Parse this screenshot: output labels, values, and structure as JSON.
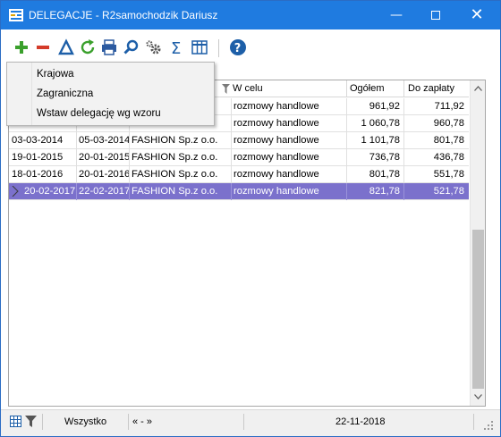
{
  "window": {
    "title": "DELEGACJE - R2samochodzik Dariusz"
  },
  "menu": {
    "items": [
      {
        "label": "Krajowa"
      },
      {
        "label": "Zagraniczna"
      },
      {
        "label": "Wstaw delegację wg wzoru"
      }
    ]
  },
  "grid": {
    "columns": [
      {
        "label": "W celu"
      },
      {
        "label": "Ogółem"
      },
      {
        "label": "Do zapłaty"
      }
    ],
    "rows": [
      {
        "od": "",
        "do": "",
        "firma": "",
        "cel": "rozmowy handlowe",
        "ogolem": "961,92",
        "doZaplaty": "711,92"
      },
      {
        "od": "",
        "do": "",
        "firma": "",
        "cel": "rozmowy handlowe",
        "ogolem": "1 060,78",
        "doZaplaty": "960,78"
      },
      {
        "od": "03-03-2014",
        "do": "05-03-2014",
        "firma": "FASHION Sp.z o.o.",
        "cel": "rozmowy handlowe",
        "ogolem": "1 101,78",
        "doZaplaty": "801,78"
      },
      {
        "od": "19-01-2015",
        "do": "20-01-2015",
        "firma": "FASHION Sp.z o.o.",
        "cel": "rozmowy handlowe",
        "ogolem": "736,78",
        "doZaplaty": "436,78"
      },
      {
        "od": "18-01-2016",
        "do": "20-01-2016",
        "firma": "FASHION Sp.z o.o.",
        "cel": "rozmowy handlowe",
        "ogolem": "801,78",
        "doZaplaty": "551,78"
      },
      {
        "od": "20-02-2017",
        "do": "22-02-2017",
        "firma": "FASHION Sp.z o.o.",
        "cel": "rozmowy handlowe",
        "ogolem": "821,78",
        "doZaplaty": "521,78"
      }
    ],
    "selected_row": 6
  },
  "status": {
    "filter": "Wszystko",
    "nav": "« - »",
    "date": "22-11-2018"
  },
  "colors": {
    "titlebar": "#1f7be0",
    "selection": "#7b71cc"
  },
  "icons": [
    "add-icon",
    "remove-icon",
    "edit-icon",
    "refresh-icon",
    "print-icon",
    "search-icon",
    "settings-icon",
    "sum-icon",
    "columns-icon",
    "help-icon"
  ]
}
